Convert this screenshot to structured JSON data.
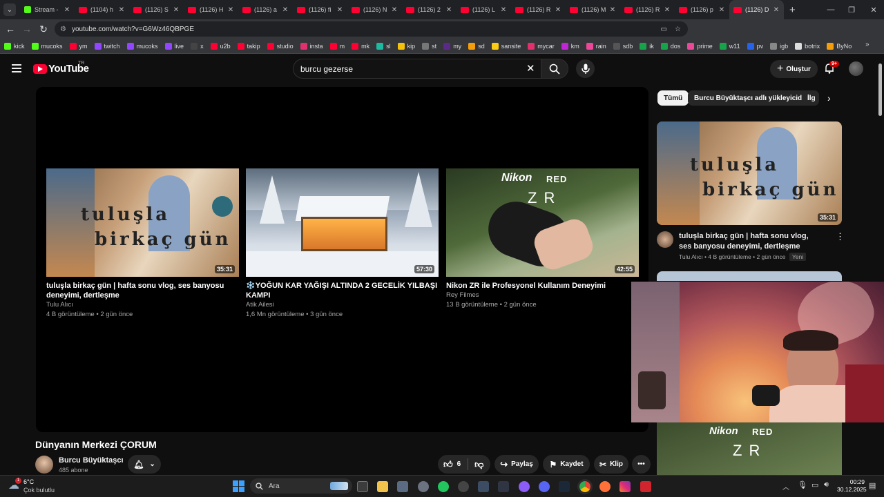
{
  "browser": {
    "tabs": [
      {
        "label": "Stream -",
        "type": "kick"
      },
      {
        "label": "(1104) h",
        "type": "yt"
      },
      {
        "label": "(1126) S",
        "type": "yt"
      },
      {
        "label": "(1126) H",
        "type": "yt"
      },
      {
        "label": "(1126) a",
        "type": "yt"
      },
      {
        "label": "(1126) fi",
        "type": "yt"
      },
      {
        "label": "(1126) N",
        "type": "yt"
      },
      {
        "label": "(1126) 2",
        "type": "yt"
      },
      {
        "label": "(1126) L",
        "type": "yt"
      },
      {
        "label": "(1126) R",
        "type": "yt"
      },
      {
        "label": "(1126) M",
        "type": "yt"
      },
      {
        "label": "(1126) R",
        "type": "yt"
      },
      {
        "label": "(1126) p",
        "type": "yt"
      },
      {
        "label": "(1126) D",
        "type": "yt",
        "active": true
      }
    ],
    "url": "youtube.com/watch?v=G6Wz46QBPGE",
    "bookmarks": [
      {
        "label": "kick",
        "color": "#53fc18"
      },
      {
        "label": "mucoks",
        "color": "#53fc18"
      },
      {
        "label": "ym",
        "color": "#ff0033"
      },
      {
        "label": "twitch",
        "color": "#9146ff"
      },
      {
        "label": "mucoks",
        "color": "#9146ff"
      },
      {
        "label": "live",
        "color": "#9146ff"
      },
      {
        "label": "x",
        "color": "#444444"
      },
      {
        "label": "u2b",
        "color": "#ff0033"
      },
      {
        "label": "takip",
        "color": "#ff0033"
      },
      {
        "label": "studio",
        "color": "#ff0033"
      },
      {
        "label": "insta",
        "color": "#e1306c"
      },
      {
        "label": "m",
        "color": "#ff0033"
      },
      {
        "label": "mk",
        "color": "#ff0033"
      },
      {
        "label": "sl",
        "color": "#1db9a0"
      },
      {
        "label": "kip",
        "color": "#f4c20d"
      },
      {
        "label": "st",
        "color": "#777777"
      },
      {
        "label": "my",
        "color": "#5b2a86"
      },
      {
        "label": "sd",
        "color": "#f59e0b"
      },
      {
        "label": "sansite",
        "color": "#facc15"
      },
      {
        "label": "mycar",
        "color": "#e1306c"
      },
      {
        "label": "km",
        "color": "#c026d3"
      },
      {
        "label": "rain",
        "color": "#ec4899"
      },
      {
        "label": "sdb",
        "color": "#555555"
      },
      {
        "label": "ik",
        "color": "#16a34a"
      },
      {
        "label": "dos",
        "color": "#16a34a"
      },
      {
        "label": "prime",
        "color": "#ec4899"
      },
      {
        "label": "w11",
        "color": "#16a34a"
      },
      {
        "label": "pv",
        "color": "#2563eb"
      },
      {
        "label": "igb",
        "color": "#888888"
      },
      {
        "label": "botrix",
        "color": "#dddddd"
      },
      {
        "label": "ByNo",
        "color": "#f59e0b"
      }
    ]
  },
  "youtube": {
    "logo_text": "YouTube",
    "country_code": "TR",
    "search_value": "burcu gezerse",
    "create_label": "Oluştur",
    "notification_count": "9+"
  },
  "endscreen": [
    {
      "title": "tuluşla birkaç gün | hafta sonu vlog, ses banyosu deneyimi, dertleşme",
      "channel": "Tulu Alıcı",
      "meta": "4 B görüntüleme • 2 gün önce",
      "duration": "35:31",
      "thumb_text": [
        "tuluşla",
        "birkaç gün"
      ]
    },
    {
      "title": "❄️YOĞUN KAR YAĞIŞI ALTINDA 2 GECELİK YILBAŞI KAMPI",
      "channel": "Atik Ailesi",
      "meta": "1,6 Mn görüntüleme • 3 gün önce",
      "duration": "57:30"
    },
    {
      "title": "Nikon ZR ile Profesyonel Kullanım Deneyimi",
      "channel": "Rey Filmes",
      "meta": "13 B görüntüleme • 2 gün önce",
      "duration": "42:55",
      "thumb_text": [
        "Nikon",
        "RED",
        "Z R"
      ]
    }
  ],
  "video": {
    "title": "Dünyanın Merkezi ÇORUM",
    "channel": "Burcu Büyüktaşcı",
    "subscribers": "485 abone",
    "likes": "6",
    "share_label": "Paylaş",
    "save_label": "Kaydet",
    "clip_label": "Klip"
  },
  "chips": [
    "Tümü",
    "Burcu Büyüktaşcı adlı yükleyiciden",
    "İlg"
  ],
  "related": [
    {
      "title": "tuluşla birkaç gün | hafta sonu vlog, ses banyosu deneyimi, dertleşme",
      "channel": "Tulu Alıcı",
      "meta": "4 B görüntüleme • 2 gün önce",
      "badge": "Yeni",
      "duration": "35:31"
    },
    {
      "thumb_text": [
        "Nikon",
        "RED",
        "Z R"
      ]
    }
  ],
  "taskbar": {
    "weather_temp": "6°C",
    "weather_desc": "Çok bulutlu",
    "search_placeholder": "Ara",
    "time": "00:29",
    "date": "30.12.2025"
  }
}
